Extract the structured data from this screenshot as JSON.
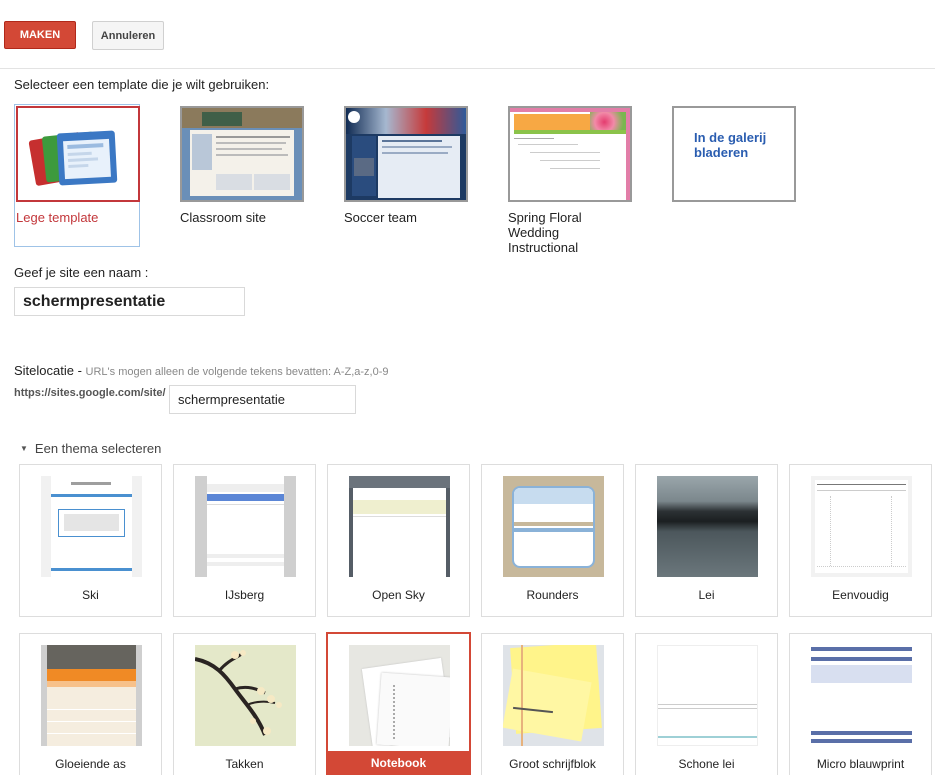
{
  "toolbar": {
    "create_label": "MAKEN",
    "cancel_label": "Annuleren"
  },
  "template_section": {
    "heading": "Selecteer een template die je wilt gebruiken:",
    "templates": [
      {
        "label": "Lege template",
        "selected": true
      },
      {
        "label": "Classroom site"
      },
      {
        "label": "Soccer team"
      },
      {
        "label": "Spring Floral Wedding Instructional"
      }
    ],
    "gallery_label": "In de galerij bladeren"
  },
  "site_name": {
    "label": "Geef je site een naam :",
    "value": "schermpresentatie"
  },
  "site_location": {
    "label": "Sitelocatie -",
    "hint": "URL's mogen alleen de volgende tekens bevatten: A-Z,a-z,0-9",
    "url_prefix": "https://sites.google.com/site/",
    "value": "schermpresentatie"
  },
  "theme_section": {
    "toggle_label": "Een thema selecteren",
    "themes": [
      {
        "name": "Ski"
      },
      {
        "name": "IJsberg"
      },
      {
        "name": "Open Sky"
      },
      {
        "name": "Rounders"
      },
      {
        "name": "Lei"
      },
      {
        "name": "Eenvoudig"
      },
      {
        "name": "Gloeiende as"
      },
      {
        "name": "Takken"
      },
      {
        "name": "Notebook",
        "selected": true
      },
      {
        "name": "Groot schrijfblok"
      },
      {
        "name": "Schone lei"
      },
      {
        "name": "Micro blauwprint"
      }
    ]
  },
  "colors": {
    "accent": "#d34836",
    "link": "#2a5db0",
    "selected_template": "#c3373b"
  }
}
